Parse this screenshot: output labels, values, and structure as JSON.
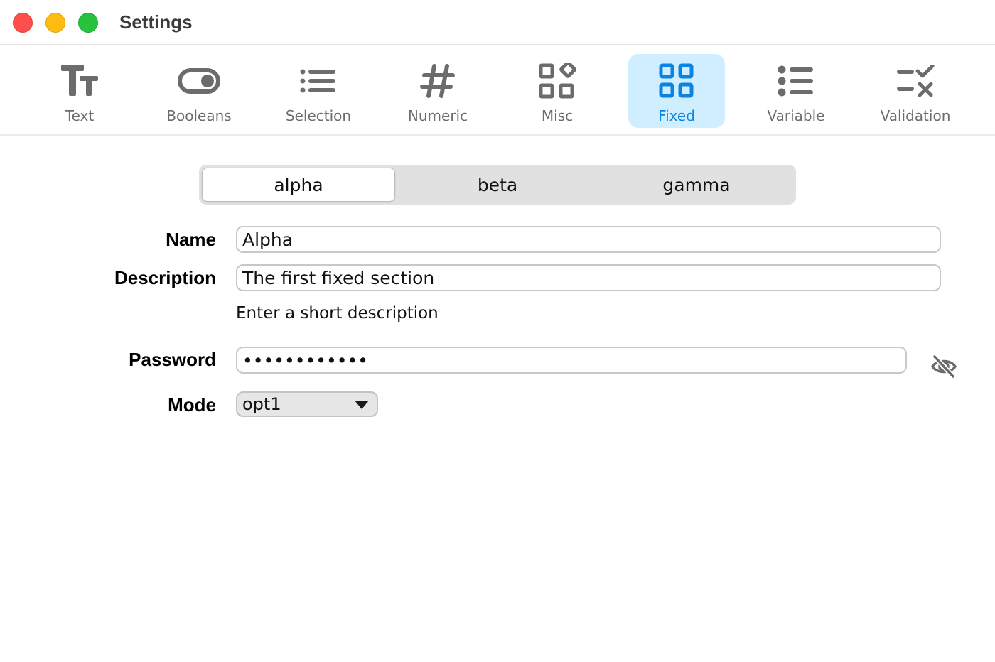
{
  "window": {
    "title": "Settings"
  },
  "toolbar": {
    "items": [
      {
        "label": "Text",
        "icon": "text-size-icon"
      },
      {
        "label": "Booleans",
        "icon": "toggle-icon"
      },
      {
        "label": "Selection",
        "icon": "list-icon"
      },
      {
        "label": "Numeric",
        "icon": "hash-icon"
      },
      {
        "label": "Misc",
        "icon": "shapes-icon"
      },
      {
        "label": "Fixed",
        "icon": "grid-icon",
        "active": true
      },
      {
        "label": "Variable",
        "icon": "bullet-list-icon"
      },
      {
        "label": "Validation",
        "icon": "checklist-icon"
      }
    ],
    "active_color": "#0a84e0",
    "active_bg": "#cfeeff"
  },
  "segments": {
    "items": [
      "alpha",
      "beta",
      "gamma"
    ],
    "selected": "alpha"
  },
  "form": {
    "name_label": "Name",
    "name_value": "Alpha",
    "description_label": "Description",
    "description_value": "The first fixed section",
    "description_hint": "Enter a short description",
    "password_label": "Password",
    "password_value": "aaaaaaaaaaaa",
    "password_icon": "eye-slash-icon",
    "mode_label": "Mode",
    "mode_value": "opt1"
  }
}
